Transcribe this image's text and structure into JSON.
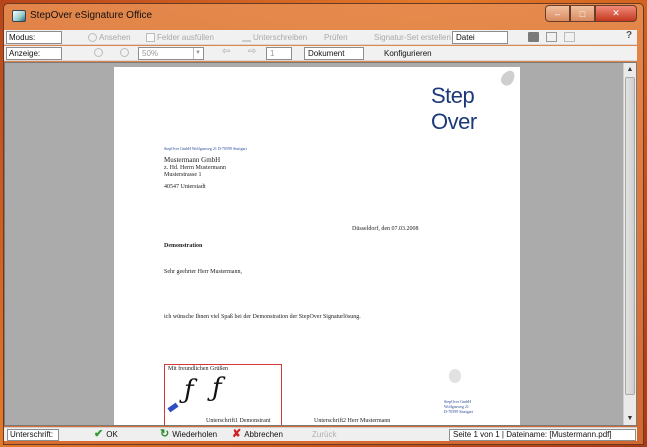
{
  "window": {
    "title": "StepOver eSignature Office"
  },
  "toolbar1": {
    "mode_label": "Modus:",
    "view": "Ansehen",
    "fill": "Felder ausfüllen",
    "sign": "Unterschreiben",
    "check": "Prüfen",
    "signature_set": "Signatur-Set erstellen",
    "file_value": "Datei",
    "help": "?"
  },
  "toolbar2": {
    "display_label": "Anzeige:",
    "zoom_value": "50%",
    "page_value": "1",
    "document_label": "Dokument",
    "configure": "Konfigurieren"
  },
  "document": {
    "logo": "Step Over",
    "sender_line": "StepOver GmbH   Wolfgasweg 21   D-70599 Stuttgart",
    "recipient": [
      "Mustermann GmbH",
      "z. Hd. Herrn Mustermann",
      "Musterstrasse 1"
    ],
    "recipient_city": "40547 Unterstadt",
    "date_line": "Düsseldorf, den 07.03.2008",
    "subject": "Demonstration",
    "salutation": "Sehr geehrter Herr Mustermann,",
    "body": "ich wünsche Ihnen viel Spaß bei der Demonstration der StepOver Signaturlösung.",
    "closing": "Mit freundlichen Grüßen",
    "sig1_caption": "Unterschrift1 Demonstrant",
    "sig2_caption": "Unterschrift2 Herr Mustermann",
    "small_sender": [
      "StepOver GmbH",
      "Wolfgasweg 21",
      "D-70599 Stuttgart"
    ]
  },
  "statusbar": {
    "label": "Unterschrift:",
    "ok": "OK",
    "repeat": "Wiederholen",
    "cancel": "Abbrechen",
    "back": "Zurück",
    "info": "Seite 1 von 1  |  Dateiname: [Mustermann.pdf]"
  }
}
